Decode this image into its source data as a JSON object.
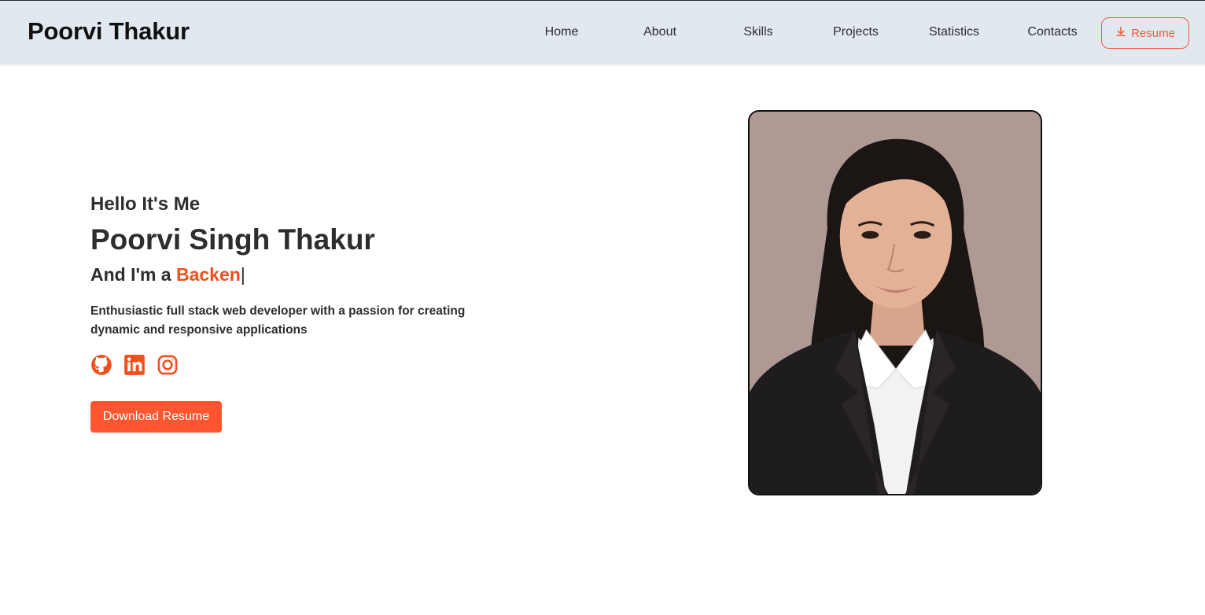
{
  "navbar": {
    "brand": "Poorvi Thakur",
    "items": [
      {
        "label": "Home"
      },
      {
        "label": "About"
      },
      {
        "label": "Skills"
      },
      {
        "label": "Projects"
      },
      {
        "label": "Statistics"
      },
      {
        "label": "Contacts"
      }
    ],
    "resume_label": "Resume",
    "resume_icon": "download-icon"
  },
  "hero": {
    "greeting": "Hello It's Me",
    "name": "Poorvi Singh Thakur",
    "role_prefix": "And I'm a ",
    "role_typed": "Backen",
    "cursor": "|",
    "description": "Enthusiastic full stack web developer with a passion for creating dynamic and responsive applications",
    "socials": [
      {
        "icon": "github-icon"
      },
      {
        "icon": "linkedin-icon"
      },
      {
        "icon": "instagram-icon"
      }
    ],
    "download_label": "Download Resume"
  },
  "colors": {
    "accent": "#f0501e",
    "button": "#ff5530",
    "navbar_bg": "#e2e8f0",
    "text": "#2d2d2d"
  }
}
